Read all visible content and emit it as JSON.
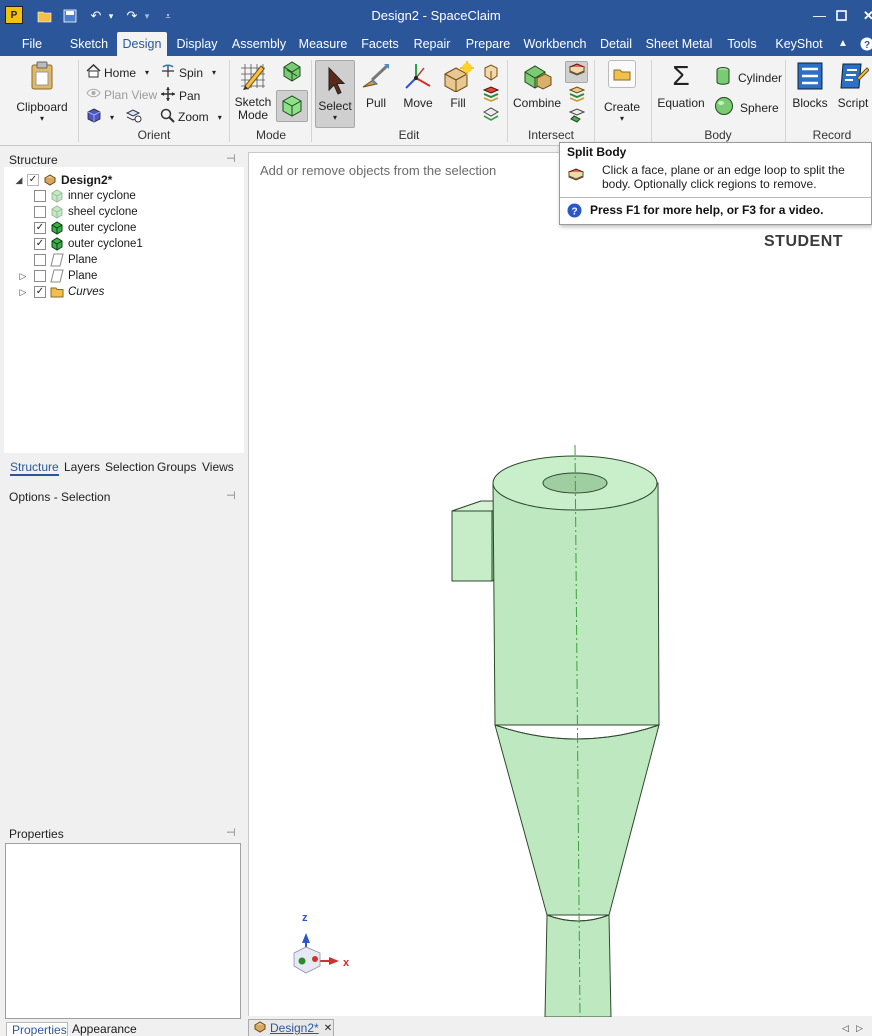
{
  "title_bar": {
    "title": "Design2 - SpaceClaim",
    "logo_letter": "P"
  },
  "tabs": [
    "File",
    "Sketch",
    "Design",
    "Display",
    "Assembly",
    "Measure",
    "Facets",
    "Repair",
    "Prepare",
    "Workbench",
    "Detail",
    "Sheet Metal",
    "Tools",
    "KeyShot"
  ],
  "active_tab": "Design",
  "ribbon": {
    "clipboard": {
      "label": "Clipboard"
    },
    "orient": {
      "group": "Orient",
      "home": "Home",
      "spin": "Spin",
      "plan_view": "Plan View",
      "pan": "Pan",
      "zoom": "Zoom"
    },
    "mode": {
      "group": "Mode",
      "sketch_mode": "Sketch Mode"
    },
    "edit": {
      "group": "Edit",
      "select": "Select",
      "pull": "Pull",
      "move": "Move",
      "fill": "Fill"
    },
    "intersect": {
      "group": "Intersect",
      "combine": "Combine"
    },
    "create": {
      "label": "Create"
    },
    "body": {
      "group": "Body",
      "equation": "Equation",
      "cylinder": "Cylinder",
      "sphere": "Sphere"
    },
    "record": {
      "group": "Record",
      "blocks": "Blocks",
      "script": "Script"
    }
  },
  "structure": {
    "title": "Structure",
    "root": "Design2*",
    "items": [
      {
        "label": "inner cyclone",
        "checked": false,
        "icon": "body-icon-faded"
      },
      {
        "label": "sheel cyclone",
        "checked": false,
        "icon": "body-icon-faded"
      },
      {
        "label": "outer cyclone",
        "checked": true,
        "icon": "body-icon"
      },
      {
        "label": "outer cyclone1",
        "checked": true,
        "icon": "body-icon"
      },
      {
        "label": "Plane",
        "checked": false,
        "icon": "plane-icon"
      },
      {
        "label": "Plane",
        "checked": false,
        "icon": "plane-icon"
      },
      {
        "label": "Curves",
        "checked": true,
        "icon": "folder-icon"
      }
    ]
  },
  "panel_tabs": [
    "Structure",
    "Layers",
    "Selection",
    "Groups",
    "Views"
  ],
  "options_title": "Options - Selection",
  "properties_title": "Properties",
  "bottom_tabs": [
    "Properties",
    "Appearance"
  ],
  "viewport": {
    "hint": "Add or remove objects from the selection",
    "license": "STUDENT",
    "axis_z": "z",
    "axis_x": "x"
  },
  "tooltip": {
    "title": "Split Body",
    "body": "Click a face, plane or an edge loop to split the body. Optionally click regions to remove.",
    "help": "Press F1 for more help, or F3 for a video."
  },
  "doc_tab": "Design2*",
  "colors": {
    "accent": "#2b579a",
    "body_fill": "#bde8c0",
    "body_edge": "#2e4a2e"
  }
}
